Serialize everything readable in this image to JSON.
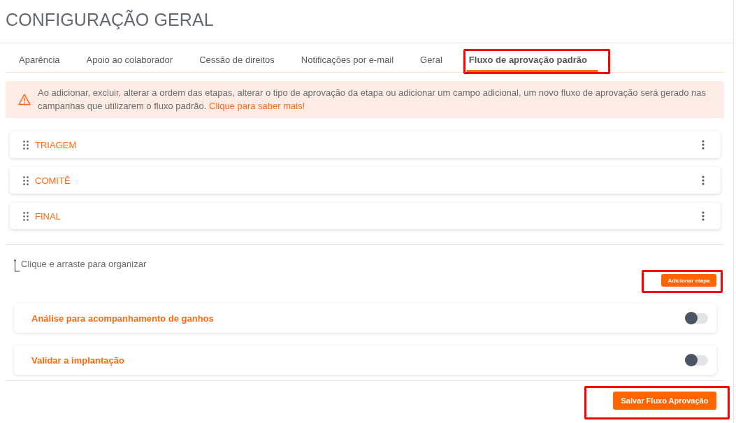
{
  "page": {
    "title": "CONFIGURAÇÃO GERAL"
  },
  "tabs": [
    {
      "label": "Aparência",
      "selected": false,
      "highlighted": false
    },
    {
      "label": "Apoio ao colaborador",
      "selected": false,
      "highlighted": false
    },
    {
      "label": "Cessão de direitos",
      "selected": false,
      "highlighted": false
    },
    {
      "label": "Notificações por e-mail",
      "selected": false,
      "highlighted": false
    },
    {
      "label": "Geral",
      "selected": false,
      "highlighted": false
    },
    {
      "label": "Fluxo de aprovação padrão",
      "selected": true,
      "highlighted": true
    }
  ],
  "alert": {
    "text": "Ao adicionar, excluir, alterar a ordem das etapas, alterar o tipo de aprovação da etapa ou adicionar um campo adicional, um novo fluxo de aprovação será gerado nas campanhas que utilizarem o fluxo padrão.",
    "link": "Clique para saber mais!"
  },
  "stages": [
    {
      "label": "TRIAGEM"
    },
    {
      "label": "COMITÊ"
    },
    {
      "label": "FINAL"
    }
  ],
  "hint": "Clique e arraste para organizar",
  "add_button": {
    "label": "Adicionar etapa",
    "highlighted": true
  },
  "options": [
    {
      "label": "Análise para acompanhamento de ganhos",
      "on": false
    },
    {
      "label": "Validar a implantação",
      "on": false
    }
  ],
  "save_button": {
    "label": "Salvar Fluxo Aprovação",
    "highlighted": true
  }
}
